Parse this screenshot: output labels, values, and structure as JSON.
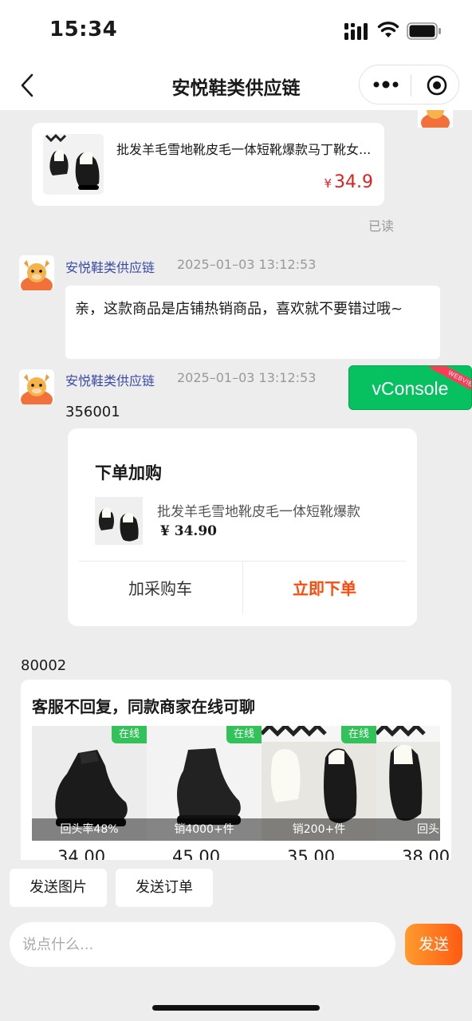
{
  "status_bar": {
    "time": "15:34"
  },
  "nav": {
    "title": "安悦鞋类供应链"
  },
  "product_message": {
    "title": "批发羊毛雪地靴皮毛一体短靴爆款马丁靴女...",
    "currency": "¥",
    "price": "34.9",
    "read_status": "已读"
  },
  "messages": [
    {
      "sender": "安悦鞋类供应链",
      "time": "2025–01–03 13:12:53",
      "text": "亲，这款商品是店铺热销商品，喜欢就不要错过哦~"
    },
    {
      "sender": "安悦鞋类供应链",
      "time": "2025–01–03 13:12:53",
      "code": "356001"
    }
  ],
  "order_card": {
    "title": "下单加购",
    "product_name": "批发羊毛雪地靴皮毛一体短靴爆款",
    "price": "¥ 34.90",
    "cart_label": "加采购车",
    "buy_label": "立即下单"
  },
  "code2": "80002",
  "recommend": {
    "title": "客服不回复，同款商家在线可聊",
    "online_label": "在线",
    "items": [
      {
        "stat": "回头率48%",
        "price": "34.00"
      },
      {
        "stat": "销4000+件",
        "price": "45.00"
      },
      {
        "stat": "销200+件",
        "price": "35.00"
      },
      {
        "stat": "回头率",
        "price": "38.00"
      }
    ]
  },
  "vconsole": {
    "label": "vConsole",
    "tag": "WEBVIEW"
  },
  "quick_actions": {
    "send_image": "发送图片",
    "send_order": "发送订单"
  },
  "input": {
    "placeholder": "说点什么..."
  },
  "send_label": "发送",
  "colors": {
    "accent": "#ff4a0a",
    "price_red": "#e02020",
    "online_green": "#33c25a",
    "vconsole_green": "#07c160",
    "sender_blue": "#3b4aa6"
  }
}
